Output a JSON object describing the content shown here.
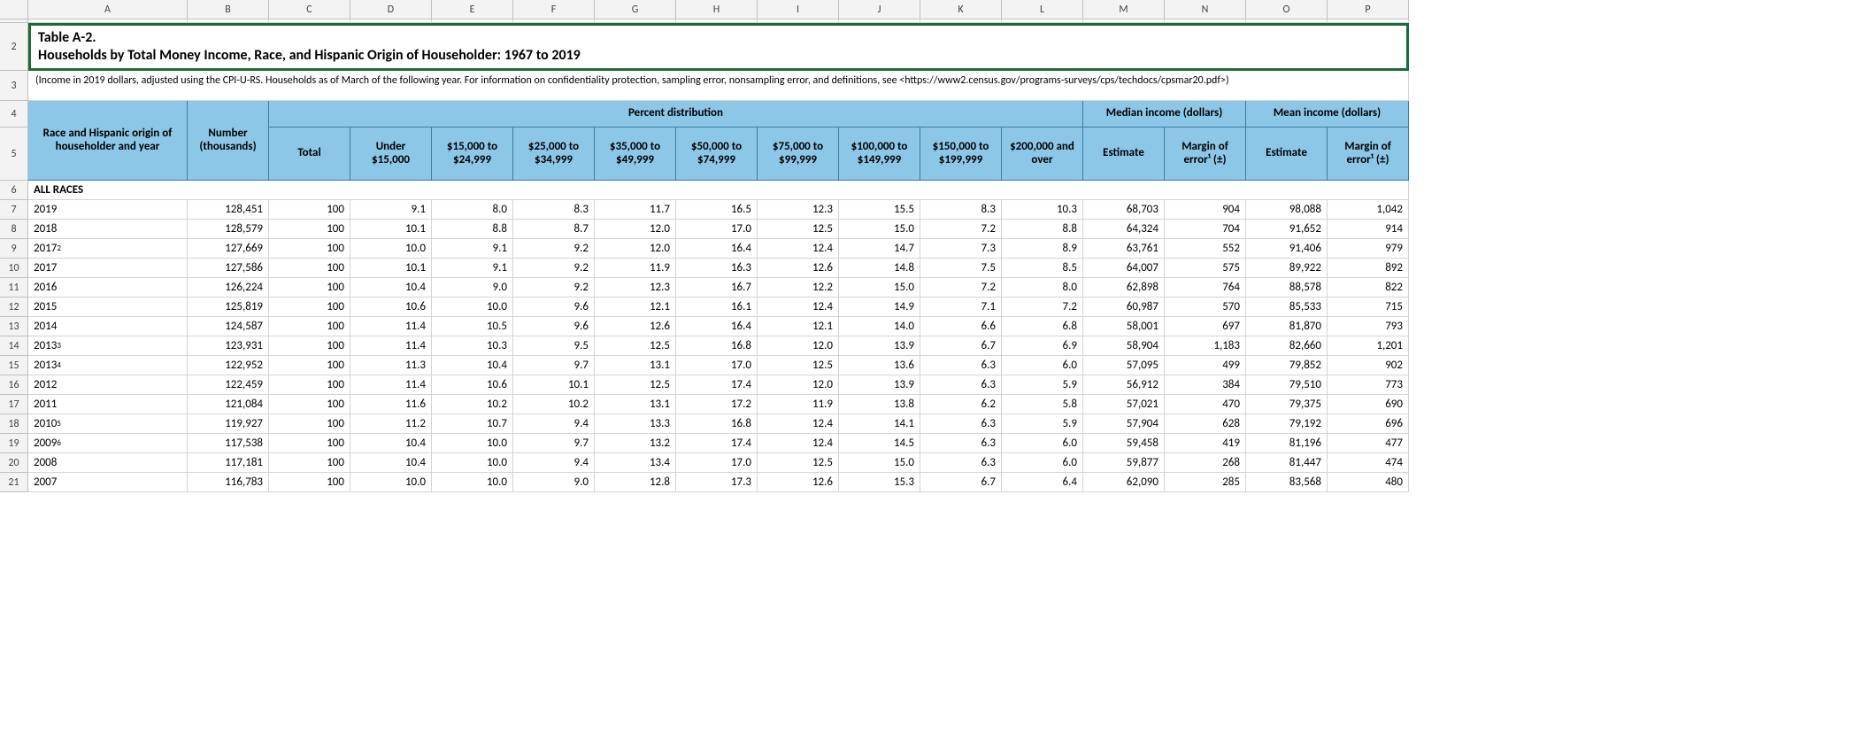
{
  "columns": [
    "A",
    "B",
    "C",
    "D",
    "E",
    "F",
    "G",
    "H",
    "I",
    "J",
    "K",
    "L",
    "M",
    "N",
    "O",
    "P"
  ],
  "title_line1": "Table A-2.",
  "title_line2": "Households by Total Money Income, Race, and Hispanic Origin of Householder: 1967 to 2019",
  "subtitle": "(Income in 2019 dollars, adjusted using the CPI-U-RS. Households as of March of the following year. For information on confidentiality protection, sampling error, nonsampling error, and definitions, see <https://www2.census.gov/programs-surveys/cps/techdocs/cpsmar20.pdf>)",
  "header": {
    "race_year": "Race and Hispanic origin of householder and year",
    "number": "Number (thousands)",
    "percent_dist": "Percent distribution",
    "median": "Median income (dollars)",
    "mean": "Mean income (dollars)",
    "cols": {
      "total": "Total",
      "under15": "Under $15,000",
      "b15_25": "$15,000 to $24,999",
      "b25_35": "$25,000 to $34,999",
      "b35_50": "$35,000 to $49,999",
      "b50_75": "$50,000 to $74,999",
      "b75_100": "$75,000 to $99,999",
      "b100_150": "$100,000 to $149,999",
      "b150_200": "$150,000 to $199,999",
      "b200plus": "$200,000 and over",
      "estimate": "Estimate",
      "moe": "Margin of error¹ (±)"
    }
  },
  "section": "ALL RACES",
  "rows": [
    {
      "rn": "7",
      "year": "2019",
      "sup": "",
      "v": [
        "128,451",
        "100",
        "9.1",
        "8.0",
        "8.3",
        "11.7",
        "16.5",
        "12.3",
        "15.5",
        "8.3",
        "10.3",
        "68,703",
        "904",
        "98,088",
        "1,042"
      ]
    },
    {
      "rn": "8",
      "year": "2018",
      "sup": "",
      "v": [
        "128,579",
        "100",
        "10.1",
        "8.8",
        "8.7",
        "12.0",
        "17.0",
        "12.5",
        "15.0",
        "7.2",
        "8.8",
        "64,324",
        "704",
        "91,652",
        "914"
      ]
    },
    {
      "rn": "9",
      "year": "2017",
      "sup": "2",
      "v": [
        "127,669",
        "100",
        "10.0",
        "9.1",
        "9.2",
        "12.0",
        "16.4",
        "12.4",
        "14.7",
        "7.3",
        "8.9",
        "63,761",
        "552",
        "91,406",
        "979"
      ]
    },
    {
      "rn": "10",
      "year": "2017",
      "sup": "",
      "v": [
        "127,586",
        "100",
        "10.1",
        "9.1",
        "9.2",
        "11.9",
        "16.3",
        "12.6",
        "14.8",
        "7.5",
        "8.5",
        "64,007",
        "575",
        "89,922",
        "892"
      ]
    },
    {
      "rn": "11",
      "year": "2016",
      "sup": "",
      "v": [
        "126,224",
        "100",
        "10.4",
        "9.0",
        "9.2",
        "12.3",
        "16.7",
        "12.2",
        "15.0",
        "7.2",
        "8.0",
        "62,898",
        "764",
        "88,578",
        "822"
      ]
    },
    {
      "rn": "12",
      "year": "2015",
      "sup": "",
      "v": [
        "125,819",
        "100",
        "10.6",
        "10.0",
        "9.6",
        "12.1",
        "16.1",
        "12.4",
        "14.9",
        "7.1",
        "7.2",
        "60,987",
        "570",
        "85,533",
        "715"
      ]
    },
    {
      "rn": "13",
      "year": "2014",
      "sup": "",
      "v": [
        "124,587",
        "100",
        "11.4",
        "10.5",
        "9.6",
        "12.6",
        "16.4",
        "12.1",
        "14.0",
        "6.6",
        "6.8",
        "58,001",
        "697",
        "81,870",
        "793"
      ]
    },
    {
      "rn": "14",
      "year": "2013",
      "sup": "3",
      "v": [
        "123,931",
        "100",
        "11.4",
        "10.3",
        "9.5",
        "12.5",
        "16.8",
        "12.0",
        "13.9",
        "6.7",
        "6.9",
        "58,904",
        "1,183",
        "82,660",
        "1,201"
      ]
    },
    {
      "rn": "15",
      "year": "2013",
      "sup": "4",
      "v": [
        "122,952",
        "100",
        "11.3",
        "10.4",
        "9.7",
        "13.1",
        "17.0",
        "12.5",
        "13.6",
        "6.3",
        "6.0",
        "57,095",
        "499",
        "79,852",
        "902"
      ]
    },
    {
      "rn": "16",
      "year": "2012",
      "sup": "",
      "v": [
        "122,459",
        "100",
        "11.4",
        "10.6",
        "10.1",
        "12.5",
        "17.4",
        "12.0",
        "13.9",
        "6.3",
        "5.9",
        "56,912",
        "384",
        "79,510",
        "773"
      ]
    },
    {
      "rn": "17",
      "year": "2011",
      "sup": "",
      "v": [
        "121,084",
        "100",
        "11.6",
        "10.2",
        "10.2",
        "13.1",
        "17.2",
        "11.9",
        "13.8",
        "6.2",
        "5.8",
        "57,021",
        "470",
        "79,375",
        "690"
      ]
    },
    {
      "rn": "18",
      "year": "2010",
      "sup": "5",
      "v": [
        "119,927",
        "100",
        "11.2",
        "10.7",
        "9.4",
        "13.3",
        "16.8",
        "12.4",
        "14.1",
        "6.3",
        "5.9",
        "57,904",
        "628",
        "79,192",
        "696"
      ]
    },
    {
      "rn": "19",
      "year": "2009",
      "sup": "6",
      "v": [
        "117,538",
        "100",
        "10.4",
        "10.0",
        "9.7",
        "13.2",
        "17.4",
        "12.4",
        "14.5",
        "6.3",
        "6.0",
        "59,458",
        "419",
        "81,196",
        "477"
      ]
    },
    {
      "rn": "20",
      "year": "2008",
      "sup": "",
      "v": [
        "117,181",
        "100",
        "10.4",
        "10.0",
        "9.4",
        "13.4",
        "17.0",
        "12.5",
        "15.0",
        "6.3",
        "6.0",
        "59,877",
        "268",
        "81,447",
        "474"
      ]
    },
    {
      "rn": "21",
      "year": "2007",
      "sup": "",
      "v": [
        "116,783",
        "100",
        "10.0",
        "10.0",
        "9.0",
        "12.8",
        "17.3",
        "12.6",
        "15.3",
        "6.7",
        "6.4",
        "62,090",
        "285",
        "83,568",
        "480"
      ]
    }
  ]
}
